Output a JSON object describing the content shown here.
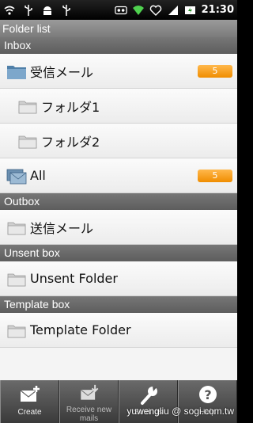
{
  "status": {
    "time": "21:30",
    "icons": [
      "wifi-icon",
      "usb-icon",
      "android-icon",
      "usb-icon",
      "voicemail-icon",
      "wifi-icon",
      "heart-icon",
      "signal-icon",
      "battery-icon"
    ]
  },
  "title": "Folder list",
  "sections": {
    "inbox": "Inbox",
    "outbox": "Outbox",
    "unsent": "Unsent box",
    "template": "Template box"
  },
  "rows": {
    "inbox_main": {
      "label": "受信メール",
      "badge": "5"
    },
    "folder1": {
      "label": "フォルダ1"
    },
    "folder2": {
      "label": "フォルダ2"
    },
    "all": {
      "label": "All",
      "badge": "5"
    },
    "sent": {
      "label": "送信メール"
    },
    "unsent_folder": {
      "label": "Unsent Folder"
    },
    "template_folder": {
      "label": "Template Folder"
    }
  },
  "toolbar": {
    "create": "Create",
    "receive": "Receive new mails",
    "settings": "Settings",
    "help": "Help"
  },
  "watermark": "yuwengliu  @ sogi.com.tw"
}
